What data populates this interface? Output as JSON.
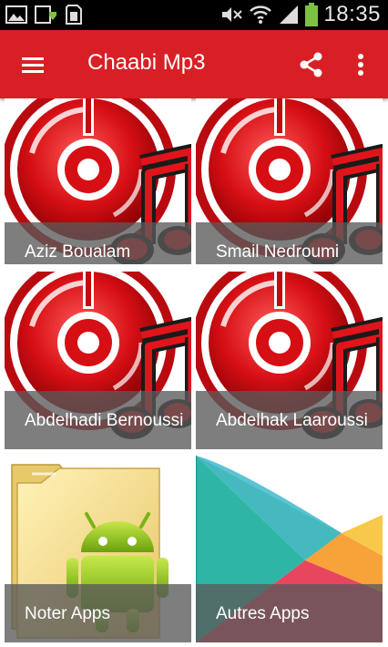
{
  "status_bar": {
    "time": "18:35",
    "left_icons": [
      "image-icon",
      "download-screenshot-icon",
      "sd-card-icon"
    ],
    "right_icons": [
      "mute-icon",
      "wifi-icon",
      "signal-icon",
      "battery-icon"
    ]
  },
  "app_bar": {
    "title": "Chaabi Mp3",
    "background": "#d91f26",
    "actions": [
      "menu-icon",
      "share-icon",
      "more-vert-icon"
    ]
  },
  "grid": {
    "items": [
      {
        "label": "Aziz Boualam",
        "icon": "music-disc-icon"
      },
      {
        "label": "Smail Nedroumi",
        "icon": "music-disc-icon"
      },
      {
        "label": "Abdelhadi Bernoussi",
        "icon": "music-disc-icon"
      },
      {
        "label": "Abdelhak Laaroussi",
        "icon": "music-disc-icon"
      },
      {
        "label": "Noter Apps",
        "icon": "android-folder-icon"
      },
      {
        "label": "Autres Apps",
        "icon": "play-store-icon"
      }
    ]
  }
}
